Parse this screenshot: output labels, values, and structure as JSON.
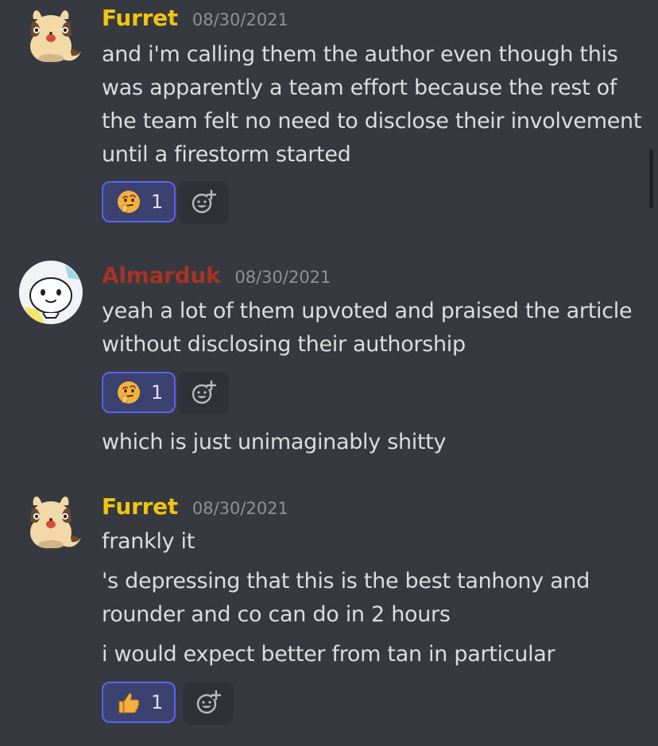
{
  "messages": [
    {
      "author": "Furret",
      "author_color": "#f1c40f",
      "timestamp": "08/30/2021",
      "avatar_icon": "furret-avatar",
      "lines": [
        "and i'm calling them the author even though this was apparently a team effort because the rest of the team felt no need to disclose their involvement until a firestorm started"
      ],
      "reaction": {
        "emoji": "thinking-face-icon",
        "count": "1"
      }
    },
    {
      "author": "Almarduk",
      "author_color": "#a93226",
      "timestamp": "08/30/2021",
      "avatar_icon": "white-creature-avatar",
      "lines": [
        "yeah a lot of them upvoted and praised the article without disclosing their authorship",
        "which is just unimaginably shitty"
      ],
      "reaction": {
        "emoji": "thinking-face-icon",
        "count": "1"
      }
    },
    {
      "author": "Furret",
      "author_color": "#f1c40f",
      "timestamp": "08/30/2021",
      "avatar_icon": "furret-avatar",
      "lines": [
        "frankly it",
        "'s depressing that this is the best tanhony and rounder and co can do in 2 hours",
        "i would expect better from tan in particular"
      ],
      "reaction": {
        "emoji": "thumbs-up-icon",
        "count": "1"
      }
    }
  ],
  "add_reaction_icon": "add-reaction-icon",
  "theme": {
    "background": "#36393f",
    "text": "#dcddde",
    "timestamp": "#8e9297",
    "reaction_border": "#5865f2",
    "reaction_bg": "#3c4270"
  }
}
